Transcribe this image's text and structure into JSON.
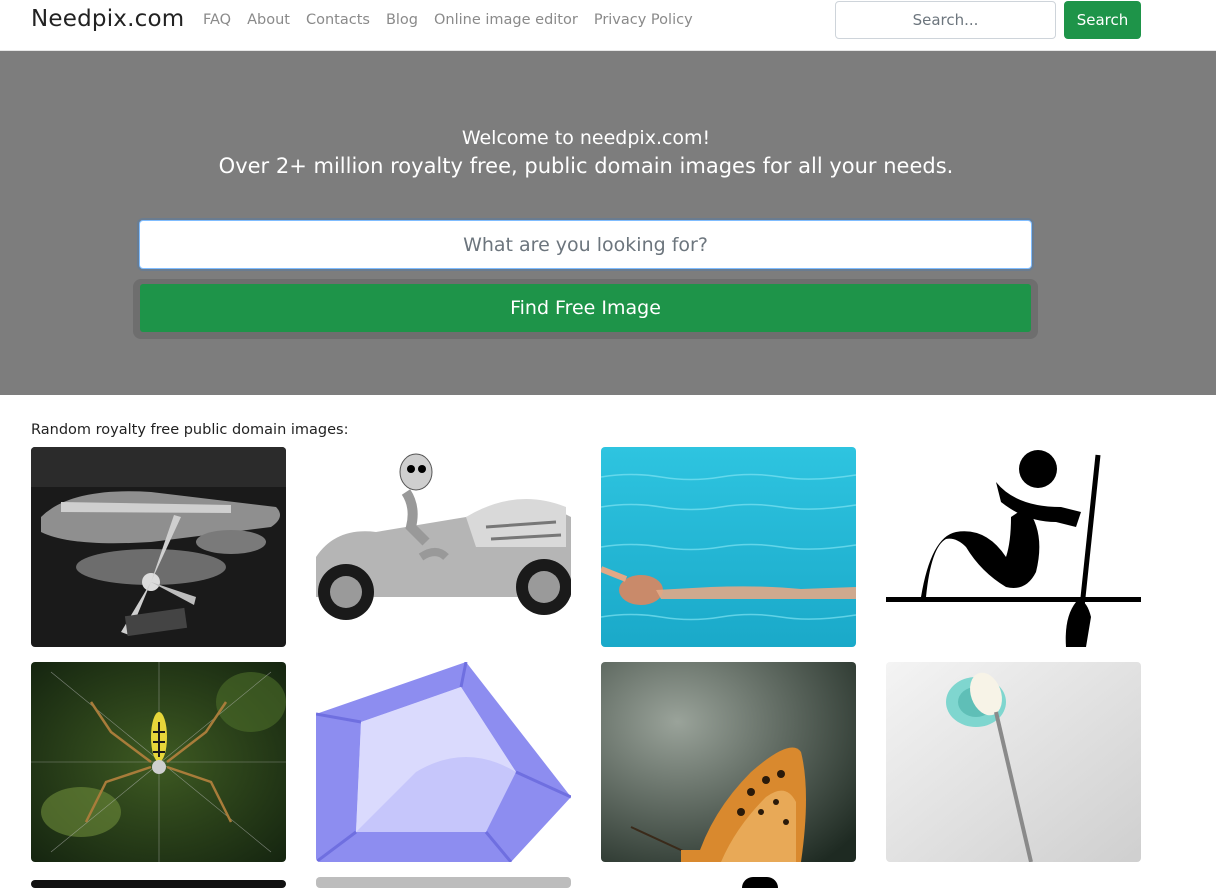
{
  "navbar": {
    "brand": "Needpix.com",
    "links": [
      "FAQ",
      "About",
      "Contacts",
      "Blog",
      "Online image editor",
      "Privacy Policy"
    ],
    "search_placeholder": "Search...",
    "search_button": "Search"
  },
  "hero": {
    "title": "Welcome to needpix.com!",
    "subtitle": "Over 2+ million royalty free, public domain images for all your needs.",
    "search_placeholder": "What are you looking for?",
    "find_button": "Find Free Image"
  },
  "gallery": {
    "label": "Random royalty free public domain images:"
  },
  "colors": {
    "accent_green": "#1e9449",
    "hero_bg": "#7d7d7d"
  }
}
